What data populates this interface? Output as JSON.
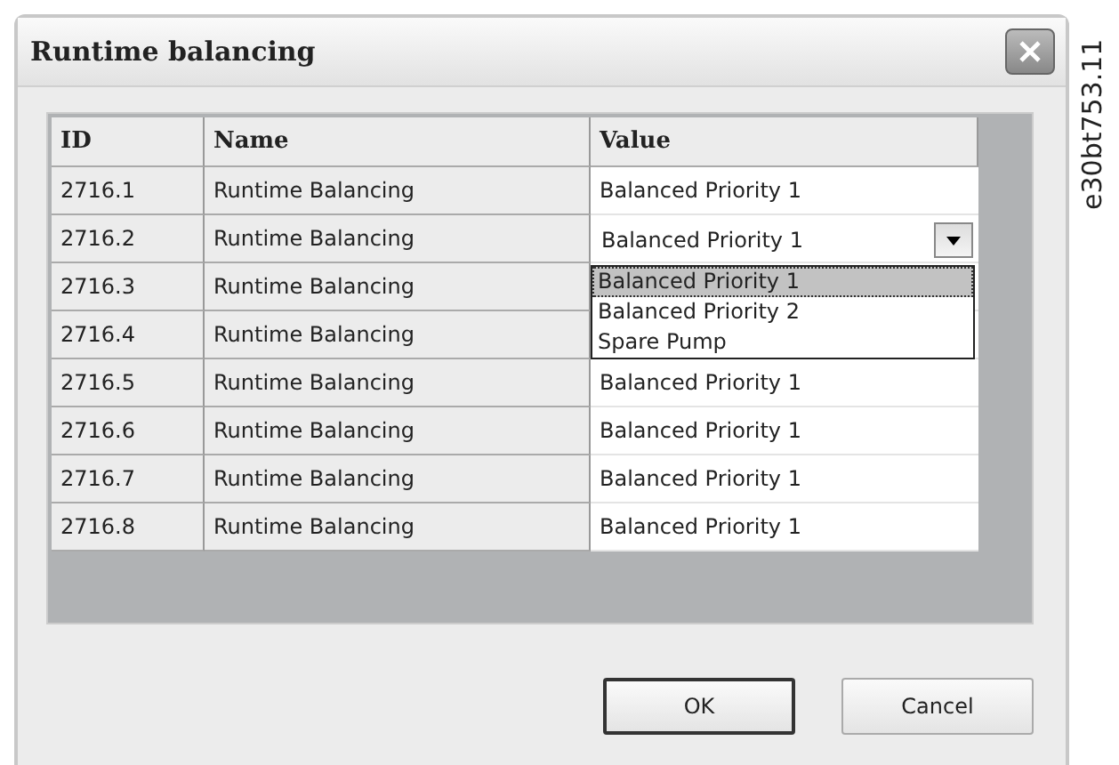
{
  "window": {
    "title": "Runtime balancing"
  },
  "figure_code": "e30bt753.11",
  "table": {
    "columns": [
      "ID",
      "Name",
      "Value"
    ],
    "rows": [
      {
        "id": "2716.1",
        "name": "Runtime Balancing",
        "kind": "text",
        "value": "Balanced Priority 1"
      },
      {
        "id": "2716.2",
        "name": "Runtime Balancing",
        "kind": "combo",
        "value": "Balanced Priority 1",
        "expanded": true,
        "options": [
          {
            "label": "Balanced Priority 1",
            "selected": true
          },
          {
            "label": "Balanced Priority 2",
            "selected": false
          },
          {
            "label": "Spare Pump",
            "selected": false
          }
        ]
      },
      {
        "id": "2716.3",
        "name": "Runtime Balancing",
        "kind": "hidden"
      },
      {
        "id": "2716.4",
        "name": "Runtime Balancing",
        "kind": "hidden"
      },
      {
        "id": "2716.5",
        "name": "Runtime Balancing",
        "kind": "text",
        "value": "Balanced Priority 1"
      },
      {
        "id": "2716.6",
        "name": "Runtime Balancing",
        "kind": "text",
        "value": "Balanced Priority 1"
      },
      {
        "id": "2716.7",
        "name": "Runtime Balancing",
        "kind": "text",
        "value": "Balanced Priority 1"
      },
      {
        "id": "2716.8",
        "name": "Runtime Balancing",
        "kind": "text",
        "value": "Balanced Priority 1"
      }
    ]
  },
  "buttons": [
    {
      "label": "OK",
      "default": true
    },
    {
      "label": "Cancel",
      "default": false
    }
  ]
}
